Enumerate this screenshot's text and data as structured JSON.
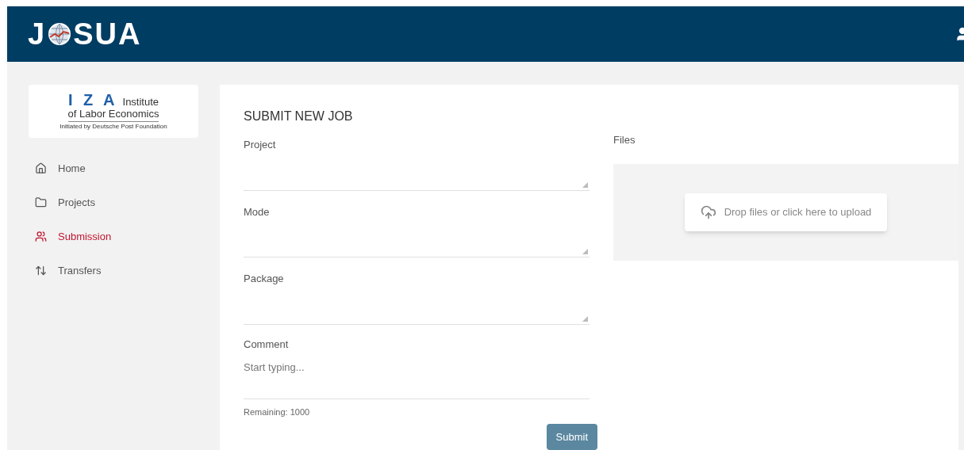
{
  "header": {
    "logo_left": "J",
    "logo_right": "SUA"
  },
  "sidebar": {
    "org_logo": {
      "letters": "I Z A",
      "line1": "Institute",
      "line2": "of Labor Economics",
      "line3": "Initiated by Deutsche Post Foundation"
    },
    "items": [
      {
        "label": "Home",
        "kind": "home",
        "selected": false
      },
      {
        "label": "Projects",
        "kind": "folder",
        "selected": false
      },
      {
        "label": "Submission",
        "kind": "people",
        "selected": true
      },
      {
        "label": "Transfers",
        "kind": "transfers",
        "selected": false
      }
    ]
  },
  "form": {
    "title": "SUBMIT NEW JOB",
    "fields": [
      {
        "label": "Project",
        "kind": "select"
      },
      {
        "label": "Mode",
        "kind": "select"
      },
      {
        "label": "Package",
        "kind": "select"
      },
      {
        "label": "Comment",
        "kind": "textarea",
        "placeholder": "Start typing..."
      }
    ],
    "remaining": "Remaining: 1000",
    "files_label": "Files",
    "upload": "Drop files or click here to upload",
    "submit": "Submit"
  }
}
